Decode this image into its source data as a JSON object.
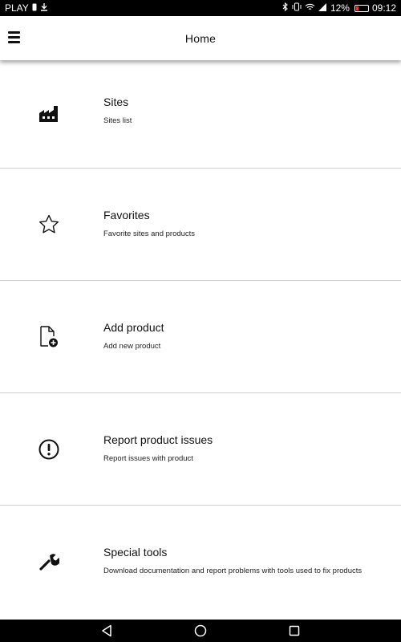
{
  "status_bar": {
    "carrier": "PLAY",
    "battery_percent": "12%",
    "time": "09:12",
    "icons": [
      "sim-icon",
      "download-icon",
      "bluetooth-icon",
      "vibrate-icon",
      "wifi-icon",
      "signal-icon",
      "battery-icon"
    ]
  },
  "app_bar": {
    "title": "Home",
    "menu_icon": "hamburger-menu-icon"
  },
  "menu_items": [
    {
      "title": "Sites",
      "subtitle": "Sites list",
      "icon": "factory-icon"
    },
    {
      "title": "Favorites",
      "subtitle": "Favorite sites and products",
      "icon": "star-icon"
    },
    {
      "title": "Add product",
      "subtitle": "Add new product",
      "icon": "add-document-icon"
    },
    {
      "title": "Report product issues",
      "subtitle": "Report issues with product",
      "icon": "exclamation-circle-icon"
    },
    {
      "title": "Special tools",
      "subtitle": "Download documentation and report problems with tools used to fix products",
      "icon": "wrench-icon"
    }
  ],
  "nav_bar": {
    "buttons": [
      "back-icon",
      "home-icon",
      "recents-icon"
    ]
  },
  "colors": {
    "background": "#ffffff",
    "text": "#111111",
    "divider": "#cfcfcf",
    "system_bars": "#000000",
    "battery_low": "#e53935"
  }
}
